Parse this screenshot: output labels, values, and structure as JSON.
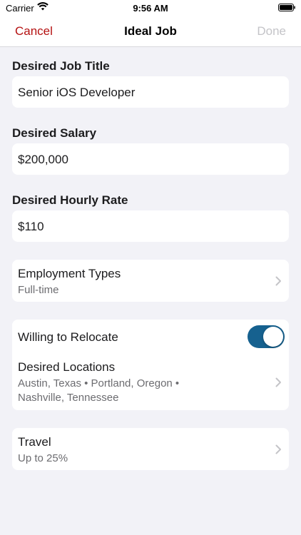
{
  "status_bar": {
    "carrier": "Carrier",
    "time": "9:56 AM",
    "icons": [
      "wifi-icon",
      "battery-icon"
    ]
  },
  "nav": {
    "cancel": "Cancel",
    "title": "Ideal Job",
    "done": "Done"
  },
  "job_title": {
    "label": "Desired Job Title",
    "value": "Senior iOS Developer"
  },
  "salary": {
    "label": "Desired Salary",
    "value": "$200,000"
  },
  "hourly_rate": {
    "label": "Desired Hourly Rate",
    "value": "$110"
  },
  "employment_types": {
    "title": "Employment Types",
    "value": "Full-time"
  },
  "relocate": {
    "title": "Willing to Relocate",
    "enabled": true
  },
  "locations": {
    "title": "Desired Locations",
    "line1": "Austin, Texas • Portland, Oregon •",
    "line2": "Nashville, Tennessee"
  },
  "travel": {
    "title": "Travel",
    "value": "Up to 25%"
  },
  "colors": {
    "accent_red": "#b51212",
    "toggle_on": "#16618f",
    "background": "#f2f2f7",
    "done_disabled": "#c4c4c8"
  }
}
